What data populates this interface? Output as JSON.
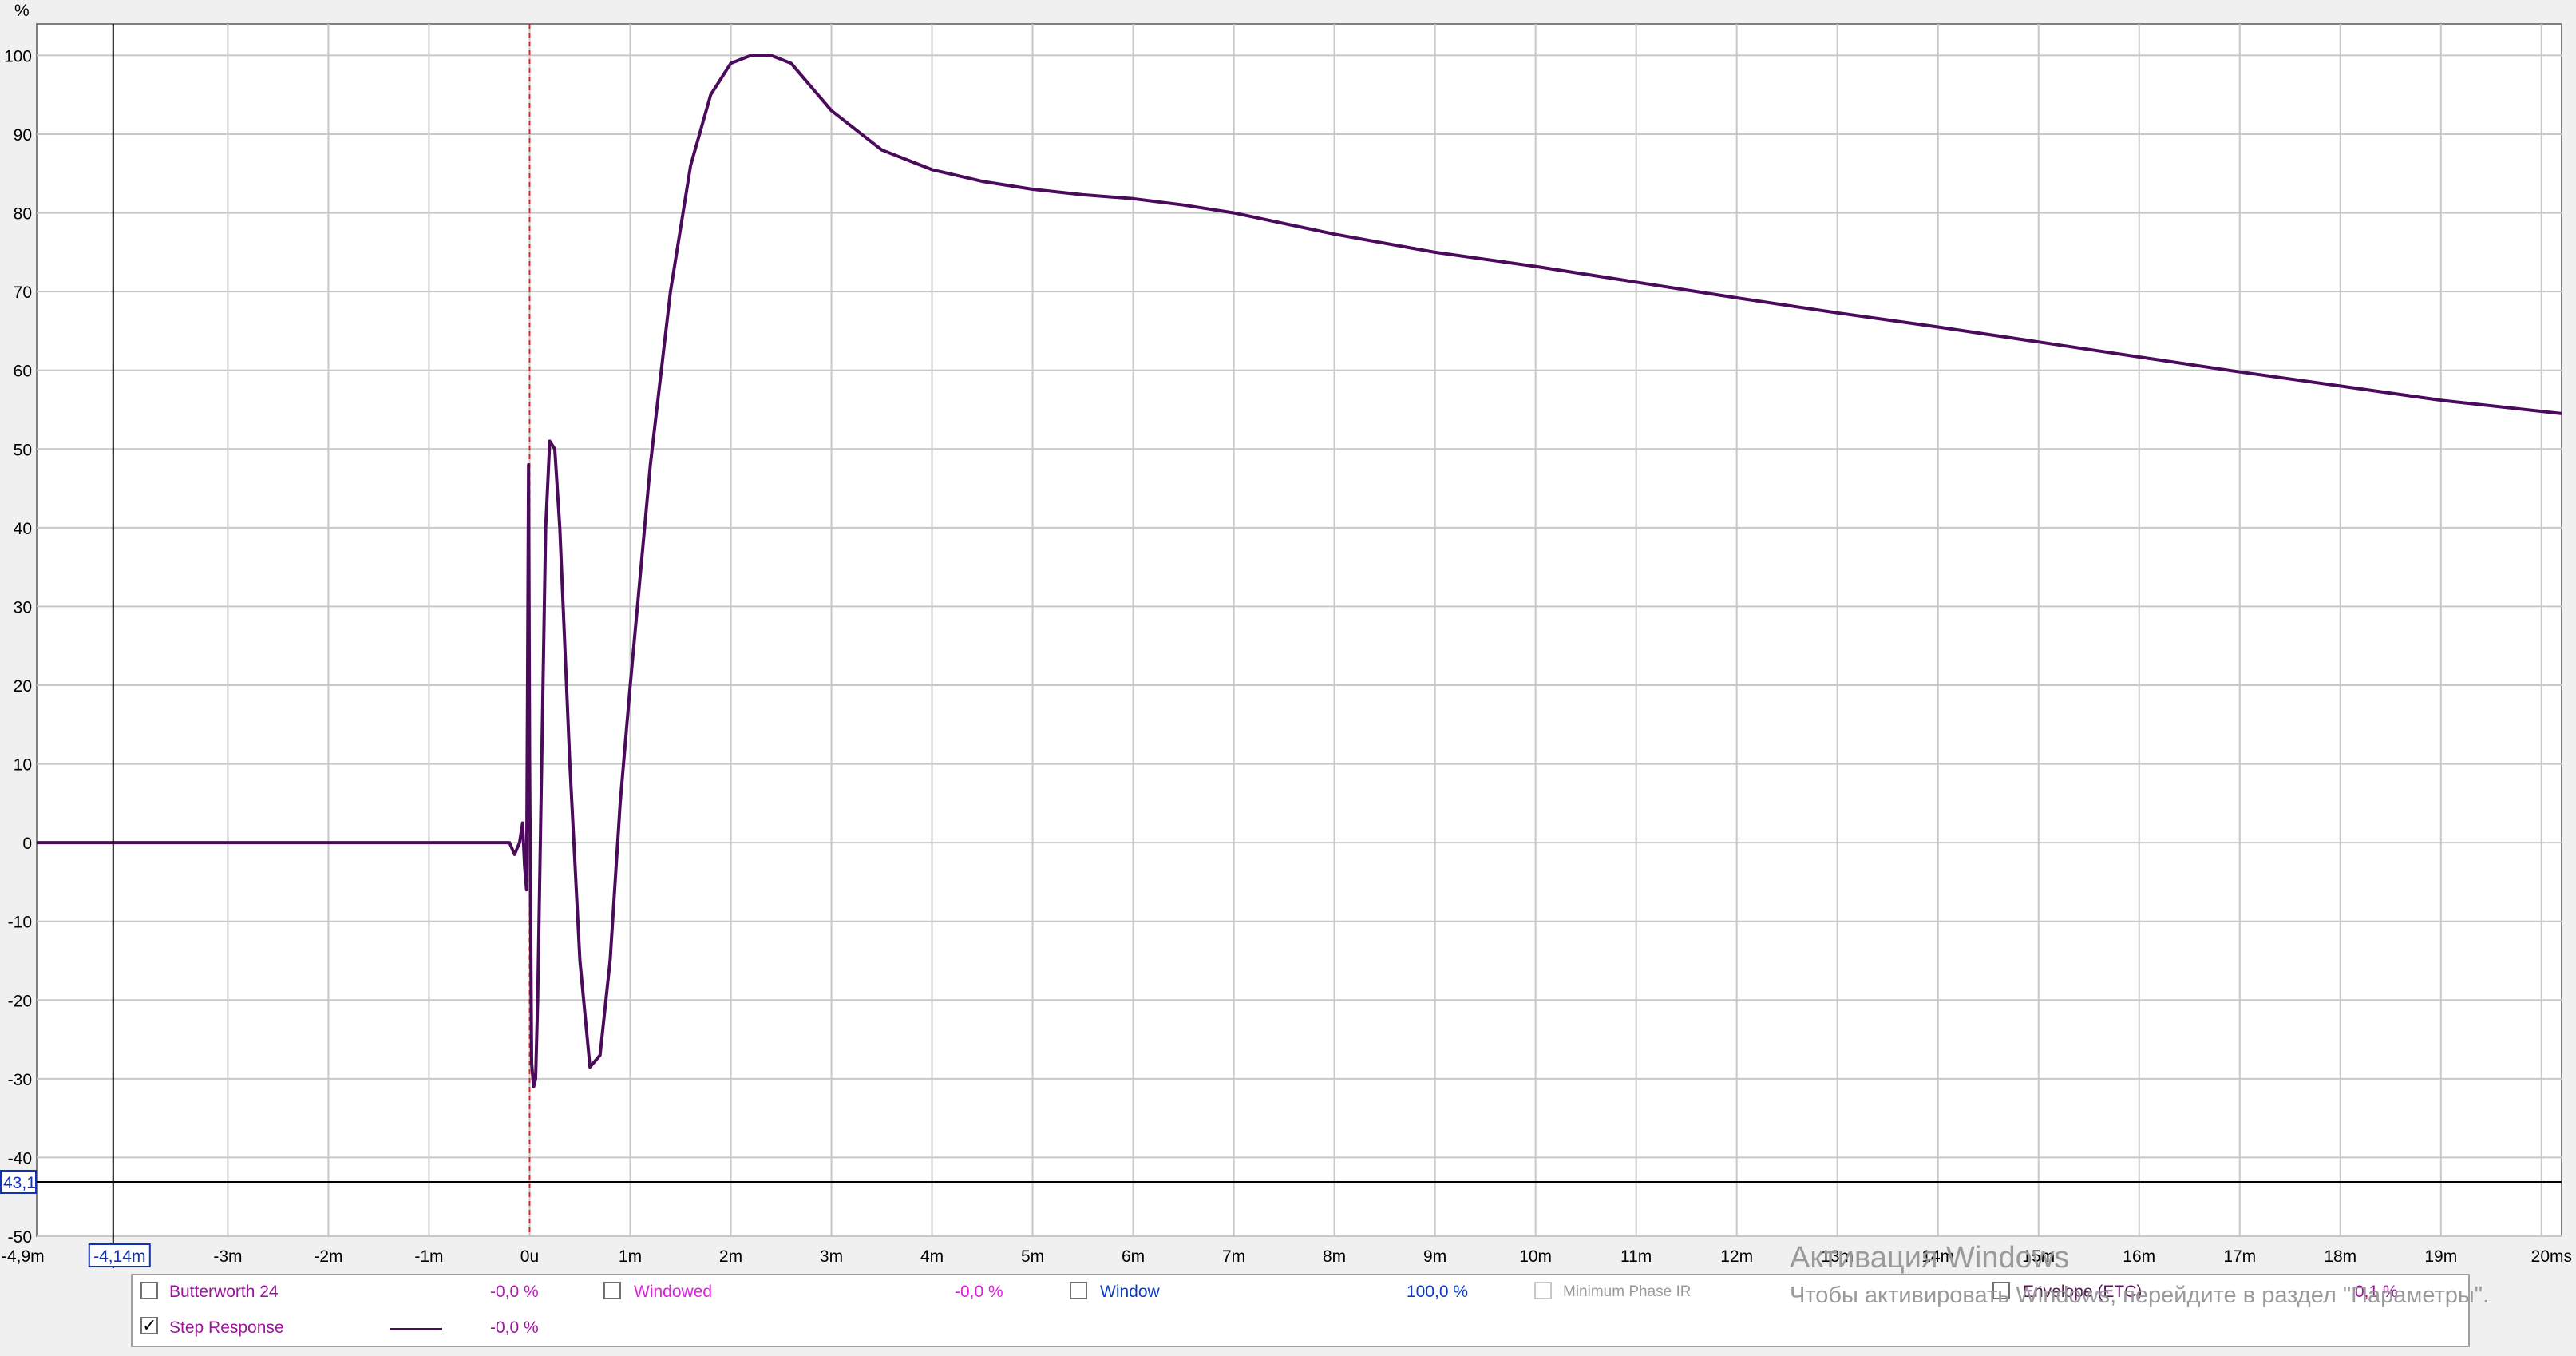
{
  "chart_data": {
    "type": "line",
    "ylabel": "%",
    "xlim": [
      -4.9,
      20.2
    ],
    "ylim": [
      -50,
      104
    ],
    "x_ticks": [
      -4.9,
      -3,
      -2,
      -1,
      0,
      1,
      2,
      3,
      4,
      5,
      6,
      7,
      8,
      9,
      10,
      11,
      12,
      13,
      14,
      15,
      16,
      17,
      18,
      19,
      20
    ],
    "x_tick_labels": [
      "-4,9m",
      "-3m",
      "-2m",
      "-1m",
      "0u",
      "1m",
      "2m",
      "3m",
      "4m",
      "5m",
      "6m",
      "7m",
      "8m",
      "9m",
      "10m",
      "11m",
      "12m",
      "13m",
      "14m",
      "15m",
      "16m",
      "17m",
      "18m",
      "19m",
      "20ms"
    ],
    "y_ticks": [
      100,
      90,
      80,
      70,
      60,
      50,
      40,
      30,
      20,
      10,
      0,
      -10,
      -20,
      -30,
      -40,
      -50
    ],
    "y_tick_labels": [
      "100",
      "90",
      "80",
      "70",
      "60",
      "50",
      "40",
      "30",
      "20",
      "10",
      "0",
      "-10",
      "-20",
      "-30",
      "-40",
      "-50"
    ],
    "grid": true,
    "reference_line_x": 0,
    "cursor": {
      "x": -4.14,
      "y": -43.1,
      "x_label": "-4,14m",
      "y_label": "43,1"
    },
    "series": [
      {
        "name": "Step Response",
        "color": "#4b0a5c",
        "x": [
          -4.9,
          -0.2,
          -0.15,
          -0.1,
          -0.07,
          -0.05,
          -0.03,
          -0.01,
          0.0,
          0.02,
          0.04,
          0.06,
          0.08,
          0.12,
          0.16,
          0.2,
          0.25,
          0.3,
          0.4,
          0.5,
          0.6,
          0.7,
          0.8,
          0.9,
          1.0,
          1.2,
          1.4,
          1.6,
          1.8,
          2.0,
          2.2,
          2.4,
          2.6,
          2.8,
          3.0,
          3.5,
          4.0,
          4.5,
          5.0,
          5.5,
          6.0,
          6.5,
          7.0,
          8.0,
          9.0,
          10.0,
          11.0,
          12.0,
          13.0,
          14.0,
          15.0,
          16.0,
          17.0,
          18.0,
          19.0,
          20.2
        ],
        "y": [
          0,
          0,
          -1.5,
          0,
          2.5,
          -3,
          -6,
          48,
          10,
          -28,
          -31,
          -30,
          -20,
          10,
          40,
          51,
          50,
          40,
          10,
          -15,
          -28.5,
          -27,
          -15,
          5,
          20,
          48,
          70,
          86,
          95,
          99,
          100,
          100,
          99,
          96,
          93,
          88,
          85.5,
          84,
          83,
          82.3,
          81.8,
          81,
          80,
          77.3,
          75,
          73.2,
          71.2,
          69.2,
          67.3,
          65.5,
          63.6,
          61.7,
          59.8,
          58,
          56.2,
          54.5
        ]
      }
    ]
  },
  "legend": {
    "items": [
      {
        "label": "Butterworth 24",
        "value": "-0,0 %",
        "checked": false,
        "color": "#9b169b",
        "value_color": "#b020b0"
      },
      {
        "label": "Windowed",
        "value": "-0,0 %",
        "checked": false,
        "color": "#e020e0",
        "value_color": "#e020e0"
      },
      {
        "label": "Window",
        "value": "100,0 %",
        "checked": false,
        "color": "#0a3cc8",
        "value_color": "#0a3cc8"
      },
      {
        "label": "Minimum Phase IR",
        "value": "",
        "checked": false,
        "color": "#9a9a9a",
        "value_color": "#9a9a9a"
      },
      {
        "label": "Envelope (ETC)",
        "value": "0,1 %",
        "checked": false,
        "color": "#5a1a5a",
        "value_color": "#9b169b"
      },
      {
        "label": "Step Response",
        "value": "-0,0 %",
        "checked": true,
        "color": "#9b169b",
        "value_color": "#9b169b"
      }
    ]
  },
  "watermark": {
    "title": "Активация Windows",
    "subtitle": "Чтобы активировать Windows, перейдите в раздел \"Параметры\"."
  },
  "colors": {
    "grid": "#c8c8c8",
    "plot_bg": "#ffffff",
    "reference_line": "#e02020",
    "cursor": "#000000",
    "cursor_label": "#1030c0"
  }
}
